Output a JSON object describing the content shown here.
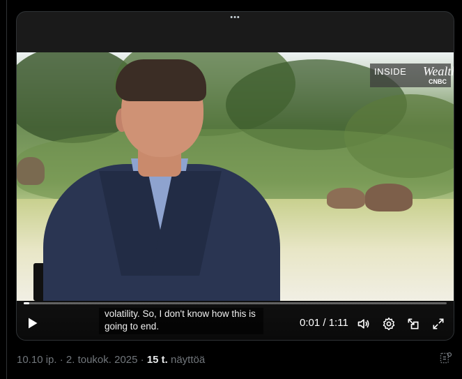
{
  "video": {
    "brand_inside": "INSIDE",
    "brand_wealth": "Wealth",
    "brand_network": "CNBC",
    "caption_line1": "volatility. So, I don't know how this is",
    "caption_line2": "going to end.",
    "current_time": "0:01",
    "duration": "1:11",
    "progress_fraction": 0.014,
    "icons": [
      "play-icon",
      "volume-icon",
      "settings-icon",
      "picture-in-picture-icon",
      "fullscreen-icon",
      "more-dots-icon"
    ]
  },
  "post_meta": {
    "time": "10.10 ip.",
    "separator": " · ",
    "date": "2. toukok. 2025",
    "views_count": "15 t.",
    "views_label": "näyttöä"
  },
  "colors": {
    "background": "#000000",
    "text_primary": "#e7e9ea",
    "text_secondary": "#71767b",
    "accent": "#1d9bf0"
  }
}
